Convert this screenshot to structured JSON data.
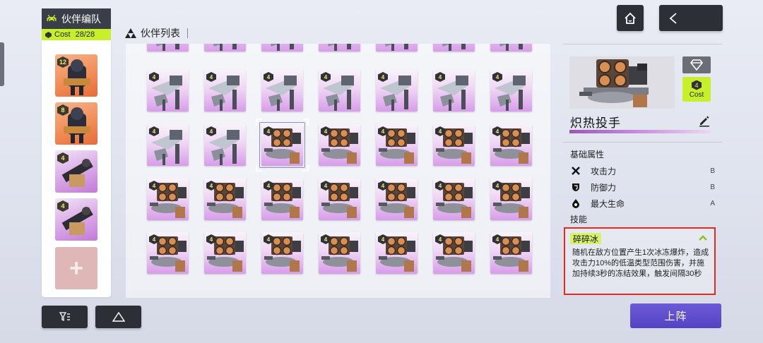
{
  "squad": {
    "title": "伙伴编队",
    "cost_label": "Cost",
    "cost_value": "28/28",
    "slots": [
      {
        "level": "12",
        "color": "orange"
      },
      {
        "level": "8",
        "color": "orange"
      },
      {
        "level": "4",
        "color": "purple"
      },
      {
        "level": "4",
        "color": "purple"
      }
    ],
    "add_icon": "plus-icon"
  },
  "list": {
    "title": "伙伴列表",
    "card_level": "4",
    "rows": [
      [
        "partial",
        "partial",
        "partial",
        "partial",
        "partial",
        "partial",
        "partial"
      ],
      [
        "drone",
        "drone",
        "drone",
        "drone",
        "drone",
        "drone",
        "drone"
      ],
      [
        "drone",
        "drone",
        "launcher",
        "launcher",
        "launcher",
        "launcher",
        "launcher"
      ],
      [
        "launcher",
        "launcher",
        "launcher",
        "launcher",
        "launcher",
        "launcher",
        "launcher"
      ],
      [
        "launcher",
        "launcher",
        "launcher",
        "launcher",
        "launcher",
        "launcher",
        "launcher"
      ]
    ],
    "selected": {
      "row": 2,
      "col": 2
    }
  },
  "detail": {
    "name": "炽热投手",
    "cost_value": "4",
    "cost_label": "Cost",
    "base_attrs_label": "基础属性",
    "attrs": [
      {
        "label": "攻击力",
        "rank": "B",
        "icon": "sword-cross-icon"
      },
      {
        "label": "防御力",
        "rank": "B",
        "icon": "shield-icon"
      },
      {
        "label": "最大生命",
        "rank": "A",
        "icon": "drop-icon"
      }
    ],
    "skills_label": "技能",
    "skill": {
      "name": "碎碎冰",
      "description": "随机在敌方位置产生1次冰冻爆炸，造成攻击力10%的低温类型范围伤害，并施加持续3秒的冻结效果，触发间隔30秒"
    }
  },
  "buttons": {
    "deploy": "上阵",
    "home_icon": "home-icon",
    "back_icon": "back-arrow-icon",
    "filter_icon": "filter-icon",
    "sort_icon": "triangle-icon"
  },
  "colors": {
    "accent_lime": "#c8f02a",
    "deploy_purple": "#5a49c8",
    "highlight_red": "#e02b20"
  }
}
